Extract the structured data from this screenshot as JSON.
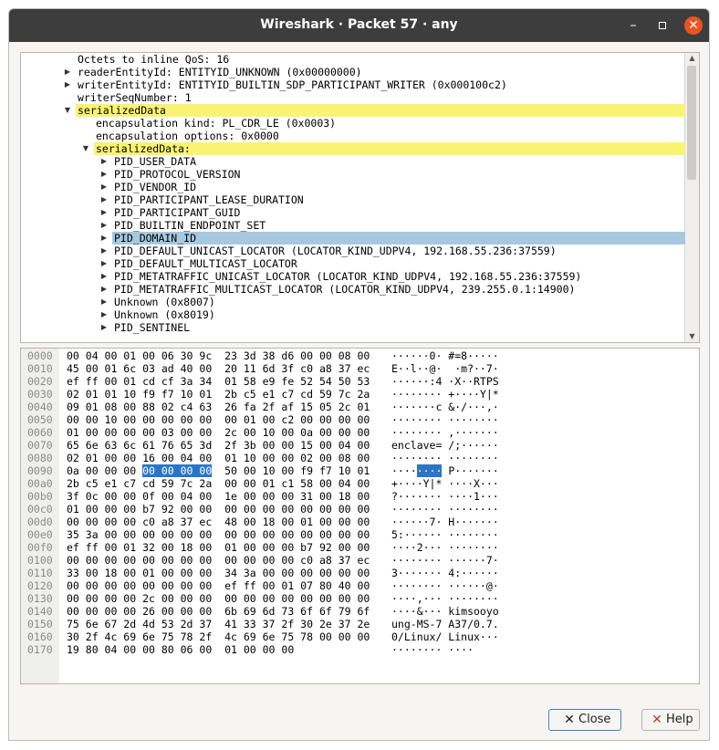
{
  "window": {
    "title": "Wireshark · Packet 57 · any"
  },
  "titlebar_controls": {
    "minimize": "–",
    "close": "✕"
  },
  "tree": {
    "rows": [
      {
        "indent": 0,
        "arrow": "none",
        "text": "Octets to inline QoS: 16",
        "hl": ""
      },
      {
        "indent": 0,
        "arrow": "collapsed",
        "text": "readerEntityId: ENTITYID_UNKNOWN (0x00000000)",
        "hl": ""
      },
      {
        "indent": 0,
        "arrow": "collapsed",
        "text": "writerEntityId: ENTITYID_BUILTIN_SDP_PARTICIPANT_WRITER (0x000100c2)",
        "hl": ""
      },
      {
        "indent": 0,
        "arrow": "none",
        "text": "writerSeqNumber: 1",
        "hl": ""
      },
      {
        "indent": 0,
        "arrow": "expanded",
        "text": "serializedData",
        "hl": "yellow"
      },
      {
        "indent": 1,
        "arrow": "none",
        "text": "encapsulation kind: PL_CDR_LE (0x0003)",
        "hl": ""
      },
      {
        "indent": 1,
        "arrow": "none",
        "text": "encapsulation options: 0x0000",
        "hl": ""
      },
      {
        "indent": 1,
        "arrow": "expanded",
        "text": "serializedData:",
        "hl": "yellow"
      },
      {
        "indent": 2,
        "arrow": "collapsed",
        "text": "PID_USER_DATA",
        "hl": ""
      },
      {
        "indent": 2,
        "arrow": "collapsed",
        "text": "PID_PROTOCOL_VERSION",
        "hl": ""
      },
      {
        "indent": 2,
        "arrow": "collapsed",
        "text": "PID_VENDOR_ID",
        "hl": ""
      },
      {
        "indent": 2,
        "arrow": "collapsed",
        "text": "PID_PARTICIPANT_LEASE_DURATION",
        "hl": ""
      },
      {
        "indent": 2,
        "arrow": "collapsed",
        "text": "PID_PARTICIPANT_GUID",
        "hl": ""
      },
      {
        "indent": 2,
        "arrow": "collapsed",
        "text": "PID_BUILTIN_ENDPOINT_SET",
        "hl": ""
      },
      {
        "indent": 2,
        "arrow": "collapsed",
        "text": "PID_DOMAIN_ID",
        "hl": "blue"
      },
      {
        "indent": 2,
        "arrow": "collapsed",
        "text": "PID_DEFAULT_UNICAST_LOCATOR (LOCATOR_KIND_UDPV4, 192.168.55.236:37559)",
        "hl": ""
      },
      {
        "indent": 2,
        "arrow": "collapsed",
        "text": "PID_DEFAULT_MULTICAST_LOCATOR",
        "hl": ""
      },
      {
        "indent": 2,
        "arrow": "collapsed",
        "text": "PID_METATRAFFIC_UNICAST_LOCATOR (LOCATOR_KIND_UDPV4, 192.168.55.236:37559)",
        "hl": ""
      },
      {
        "indent": 2,
        "arrow": "collapsed",
        "text": "PID_METATRAFFIC_MULTICAST_LOCATOR (LOCATOR_KIND_UDPV4, 239.255.0.1:14900)",
        "hl": ""
      },
      {
        "indent": 2,
        "arrow": "collapsed",
        "text": "Unknown (0x8007)",
        "hl": ""
      },
      {
        "indent": 2,
        "arrow": "collapsed",
        "text": "Unknown (0x8019)",
        "hl": ""
      },
      {
        "indent": 2,
        "arrow": "collapsed",
        "text": "PID_SENTINEL",
        "hl": ""
      }
    ]
  },
  "bytes": {
    "rows": [
      {
        "off": "0000",
        "hex_a": "00 04 00 01 00 06 30 9c  23 3d 38 d6 00 00 08 00",
        "sel": "",
        "hex_b": "",
        "asc_a": "······0· #=8·····",
        "asc_sel": "",
        "asc_b": ""
      },
      {
        "off": "0010",
        "hex_a": "45 00 01 6c 03 ad 40 00  20 11 6d 3f c0 a8 37 ec",
        "sel": "",
        "hex_b": "",
        "asc_a": "E··l··@·  ·m?··7·",
        "asc_sel": "",
        "asc_b": ""
      },
      {
        "off": "0020",
        "hex_a": "ef ff 00 01 cd cf 3a 34  01 58 e9 fe 52 54 50 53",
        "sel": "",
        "hex_b": "",
        "asc_a": "······:4 ·X··RTPS",
        "asc_sel": "",
        "asc_b": ""
      },
      {
        "off": "0030",
        "hex_a": "02 01 01 10 f9 f7 10 01  2b c5 e1 c7 cd 59 7c 2a",
        "sel": "",
        "hex_b": "",
        "asc_a": "········ +····Y|*",
        "asc_sel": "",
        "asc_b": ""
      },
      {
        "off": "0040",
        "hex_a": "09 01 08 00 88 02 c4 63  26 fa 2f af 15 05 2c 01",
        "sel": "",
        "hex_b": "",
        "asc_a": "·······c &·/···,·",
        "asc_sel": "",
        "asc_b": ""
      },
      {
        "off": "0050",
        "hex_a": "00 00 10 00 00 00 00 00  00 01 00 c2 00 00 00 00",
        "sel": "",
        "hex_b": "",
        "asc_a": "········ ········",
        "asc_sel": "",
        "asc_b": ""
      },
      {
        "off": "0060",
        "hex_a": "01 00 00 00 00 03 00 00  2c 00 10 00 0a 00 00 00",
        "sel": "",
        "hex_b": "",
        "asc_a": "········ ,·······",
        "asc_sel": "",
        "asc_b": ""
      },
      {
        "off": "0070",
        "hex_a": "65 6e 63 6c 61 76 65 3d  2f 3b 00 00 15 00 04 00",
        "sel": "",
        "hex_b": "",
        "asc_a": "enclave= /;······",
        "asc_sel": "",
        "asc_b": ""
      },
      {
        "off": "0080",
        "hex_a": "02 01 00 00 16 00 04 00  01 10 00 00 02 00 08 00",
        "sel": "",
        "hex_b": "",
        "asc_a": "········ ········",
        "asc_sel": "",
        "asc_b": ""
      },
      {
        "off": "0090",
        "hex_a": "0a 00 00 00 ",
        "sel": "00 00 00 00",
        "hex_b": "  50 00 10 00 f9 f7 10 01",
        "asc_a": "····",
        "asc_sel": "····",
        "asc_b": " P·······"
      },
      {
        "off": "00a0",
        "hex_a": "2b c5 e1 c7 cd 59 7c 2a  00 00 01 c1 58 00 04 00",
        "sel": "",
        "hex_b": "",
        "asc_a": "+····Y|* ····X···",
        "asc_sel": "",
        "asc_b": ""
      },
      {
        "off": "00b0",
        "hex_a": "3f 0c 00 00 0f 00 04 00  1e 00 00 00 31 00 18 00",
        "sel": "",
        "hex_b": "",
        "asc_a": "?······· ····1···",
        "asc_sel": "",
        "asc_b": ""
      },
      {
        "off": "00c0",
        "hex_a": "01 00 00 00 b7 92 00 00  00 00 00 00 00 00 00 00",
        "sel": "",
        "hex_b": "",
        "asc_a": "········ ········",
        "asc_sel": "",
        "asc_b": ""
      },
      {
        "off": "00d0",
        "hex_a": "00 00 00 00 c0 a8 37 ec  48 00 18 00 01 00 00 00",
        "sel": "",
        "hex_b": "",
        "asc_a": "······7· H·······",
        "asc_sel": "",
        "asc_b": ""
      },
      {
        "off": "00e0",
        "hex_a": "35 3a 00 00 00 00 00 00  00 00 00 00 00 00 00 00",
        "sel": "",
        "hex_b": "",
        "asc_a": "5:······ ········",
        "asc_sel": "",
        "asc_b": ""
      },
      {
        "off": "00f0",
        "hex_a": "ef ff 00 01 32 00 18 00  01 00 00 00 b7 92 00 00",
        "sel": "",
        "hex_b": "",
        "asc_a": "····2··· ········",
        "asc_sel": "",
        "asc_b": ""
      },
      {
        "off": "0100",
        "hex_a": "00 00 00 00 00 00 00 00  00 00 00 00 c0 a8 37 ec",
        "sel": "",
        "hex_b": "",
        "asc_a": "········ ······7·",
        "asc_sel": "",
        "asc_b": ""
      },
      {
        "off": "0110",
        "hex_a": "33 00 18 00 01 00 00 00  34 3a 00 00 00 00 00 00",
        "sel": "",
        "hex_b": "",
        "asc_a": "3······· 4:······",
        "asc_sel": "",
        "asc_b": ""
      },
      {
        "off": "0120",
        "hex_a": "00 00 00 00 00 00 00 00  ef ff 00 01 07 80 40 00",
        "sel": "",
        "hex_b": "",
        "asc_a": "········ ······@·",
        "asc_sel": "",
        "asc_b": ""
      },
      {
        "off": "0130",
        "hex_a": "00 00 00 00 2c 00 00 00  00 00 00 00 00 00 00 00",
        "sel": "",
        "hex_b": "",
        "asc_a": "····,··· ········",
        "asc_sel": "",
        "asc_b": ""
      },
      {
        "off": "0140",
        "hex_a": "00 00 00 00 26 00 00 00  6b 69 6d 73 6f 6f 79 6f",
        "sel": "",
        "hex_b": "",
        "asc_a": "····&··· kimsooyo",
        "asc_sel": "",
        "asc_b": ""
      },
      {
        "off": "0150",
        "hex_a": "75 6e 67 2d 4d 53 2d 37  41 33 37 2f 30 2e 37 2e",
        "sel": "",
        "hex_b": "",
        "asc_a": "ung-MS-7 A37/0.7.",
        "asc_sel": "",
        "asc_b": ""
      },
      {
        "off": "0160",
        "hex_a": "30 2f 4c 69 6e 75 78 2f  4c 69 6e 75 78 00 00 00",
        "sel": "",
        "hex_b": "",
        "asc_a": "0/Linux/ Linux···",
        "asc_sel": "",
        "asc_b": ""
      },
      {
        "off": "0170",
        "hex_a": "19 80 04 00 00 80 06 00  01 00 00 00",
        "sel": "",
        "hex_b": "",
        "asc_a": "········ ····",
        "asc_sel": "",
        "asc_b": ""
      }
    ]
  },
  "buttons": {
    "close_label": "Close",
    "help_label": "Help",
    "close_icon": "✕",
    "help_icon": "✕"
  },
  "colors": {
    "highlight_yellow": "#f9f372",
    "highlight_blue": "#a6c8e0",
    "byte_selection": "#2a76c6",
    "titlebar": "#3d3d3d",
    "close_button": "#e95420"
  }
}
